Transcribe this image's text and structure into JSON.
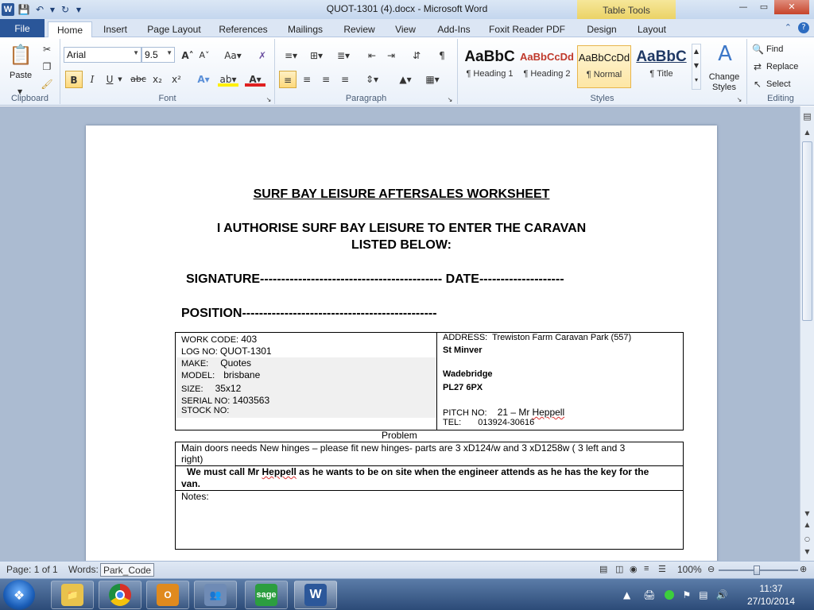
{
  "window": {
    "title": "QUOT-1301 (4).docx  -  Microsoft Word",
    "app_icon": "W",
    "contextual_tab_group": "Table Tools",
    "controls": {
      "minimize": "—",
      "maximize": "▭",
      "close": "✕"
    }
  },
  "ribbon_tabs": [
    "File",
    "Home",
    "Insert",
    "Page Layout",
    "References",
    "Mailings",
    "Review",
    "View",
    "Add-Ins",
    "Foxit Reader PDF",
    "Design",
    "Layout"
  ],
  "active_tab": "Home",
  "ribbon": {
    "clipboard": {
      "label": "Clipboard",
      "paste": "Paste"
    },
    "font": {
      "label": "Font",
      "font_name": "Arial",
      "font_size": "9.5"
    },
    "paragraph": {
      "label": "Paragraph"
    },
    "styles": {
      "label": "Styles",
      "items": [
        {
          "preview": "AaBbC",
          "name": "¶ Heading 1"
        },
        {
          "preview": "AaBbCcDd",
          "name": "¶ Heading 2"
        },
        {
          "preview": "AaBbCcDd",
          "name": "¶ Normal"
        },
        {
          "preview": "AaBbC",
          "name": "¶ Title"
        }
      ],
      "change_styles": "Change Styles"
    },
    "editing": {
      "label": "Editing",
      "find": "Find",
      "replace": "Replace",
      "select": "Select"
    }
  },
  "document": {
    "title": "SURF BAY LEISURE AFTERSALES WORKSHEET",
    "authorise_line1": "I AUTHORISE SURF BAY LEISURE TO ENTER THE CARAVAN",
    "authorise_line2": "LISTED BELOW:",
    "signature_line": "SIGNATURE------------------------------------------- DATE--------------------",
    "position_line": "POSITION----------------------------------------------",
    "left_fields": {
      "work_code_label": "WORK CODE:",
      "work_code": "403",
      "log_no_label": "LOG NO:",
      "log_no": "QUOT-1301",
      "make_label": "MAKE:",
      "make": "Quotes",
      "model_label": "MODEL:",
      "model": "brisbane",
      "size_label": "SIZE:",
      "size": "35x12",
      "serial_label": "SERIAL  NO:",
      "serial": "1403563",
      "stock_label": "STOCK NO:"
    },
    "right_fields": {
      "address_label": "ADDRESS:",
      "address": "Trewiston Farm Caravan Park (557)",
      "address_line2": "St Minver",
      "address_line3": "Wadebridge",
      "address_line4": "PL27 6PX",
      "pitch_label": "PITCH NO:",
      "pitch_num": "21 – Mr",
      "pitch_name": "Heppell",
      "tel_label": "TEL:",
      "tel": "013924-30616"
    },
    "problem_heading": "Problem",
    "problem_text_line1": "Main doors needs New hinges – please fit new hinges- parts are 3  xD124/w and 3 xD1258w ( 3 left and 3",
    "problem_text_line2": "right)",
    "call_line1_a": "We must call Mr",
    "call_line1_name": "Heppell",
    "call_line1_b": "as he wants to be on site when the engineer attends as he has the key for the",
    "call_line2": "van.",
    "notes_label": "Notes:"
  },
  "statusbar": {
    "page": "Page: 1 of 1",
    "words_label": "Words:",
    "tooltip": "Park_Code",
    "zoom": "100%"
  },
  "taskbar": {
    "apps": [
      {
        "name": "file-explorer",
        "label": ""
      },
      {
        "name": "chrome",
        "label": ""
      },
      {
        "name": "outlook",
        "label": "O"
      },
      {
        "name": "contacts",
        "label": ""
      },
      {
        "name": "sage",
        "label": "sage"
      },
      {
        "name": "word",
        "label": "W"
      }
    ],
    "time": "11:37",
    "date": "27/10/2014"
  },
  "colors": {
    "file_tab": "#2a5699",
    "table_tools": "#e9cf5e",
    "doc_background": "#abbbd1",
    "heading2_red": "#c0392b"
  }
}
